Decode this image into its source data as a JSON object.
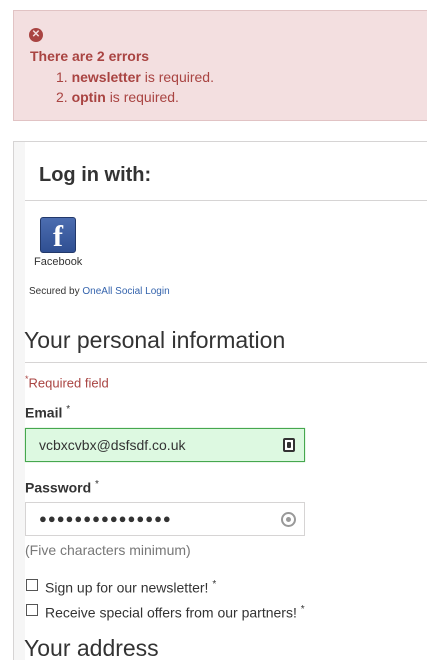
{
  "errors": {
    "title": "There are 2 errors",
    "items": [
      {
        "number": "1.",
        "field": "newsletter",
        "message": "is required."
      },
      {
        "number": "2.",
        "field": "optin",
        "message": "is required."
      }
    ]
  },
  "social_login": {
    "title": "Log in with:",
    "facebook_label": "Facebook",
    "secured_by": "Secured by",
    "provider_link": "OneAll Social Login"
  },
  "personal_info": {
    "title": "Your personal information",
    "required_marker": "*",
    "required_note": "Required field",
    "email_label": "Email",
    "email_value": "vcbxcvbx@dsfsdf.co.uk",
    "password_label": "Password",
    "password_value": "●●●●●●●●●●●●●●●",
    "password_hint": "(Five characters minimum)",
    "newsletter_label": "Sign up for our newsletter!",
    "optin_label": "Receive special offers from our partners!",
    "asterisk": "*"
  },
  "address": {
    "title": "Your address"
  },
  "colors": {
    "error_bg": "#f3dfe0",
    "error_text": "#a94442",
    "valid_bg": "#ddf9e1",
    "valid_border": "#46a74e",
    "link": "#3564ad"
  },
  "icons": {
    "error": "close-circle-icon",
    "facebook": "facebook-icon",
    "email_field": "contact-card-icon",
    "password_field": "eye-icon"
  }
}
